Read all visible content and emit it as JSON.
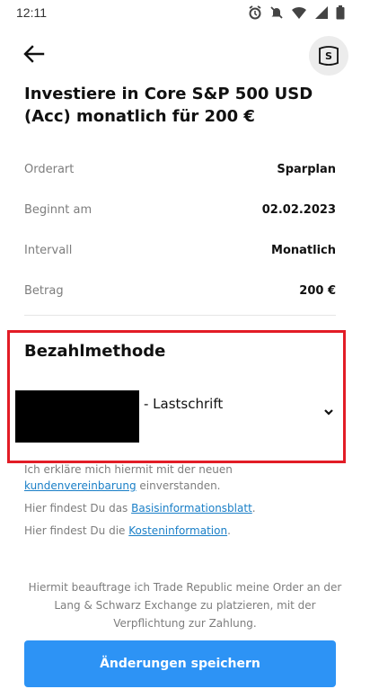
{
  "status_bar": {
    "time": "12:11",
    "icons": [
      "alarm-icon",
      "mute-icon",
      "wifi-icon",
      "signal-icon",
      "battery-icon"
    ]
  },
  "header": {
    "back_icon": "arrow-left-icon",
    "savings_icon": "savings-plan-icon",
    "savings_icon_letter": "S"
  },
  "title": "Investiere in Core S&P 500 USD (Acc) monatlich für 200 €",
  "details": [
    {
      "label": "Orderart",
      "value": "Sparplan"
    },
    {
      "label": "Beginnt am",
      "value": "02.02.2023"
    },
    {
      "label": "Intervall",
      "value": "Monatlich"
    },
    {
      "label": "Betrag",
      "value": "200 €"
    }
  ],
  "payment": {
    "heading": "Bezahlmethode",
    "method": "- Lastschrift",
    "highlight_color": "#e21c26"
  },
  "legal": {
    "line1_text": "Ich erkläre mich hiermit mit der neuen",
    "line1_link": "kundenvereinbarung",
    "line1_suffix": " einverstanden.",
    "line2_prefix": "Hier findest Du das ",
    "line2_link": "Basisinformationsblatt",
    "line2_suffix": ".",
    "line3_prefix": "Hier findest Du die ",
    "line3_link": "Kosteninformation",
    "line3_suffix": "."
  },
  "footer": {
    "disclaimer": "Hiermit beauftrage ich Trade Republic meine Order an der Lang & Schwarz Exchange zu platzieren, mit der Verpflichtung zur Zahlung.",
    "save_label": "Änderungen speichern",
    "accent_color": "#2d93f5"
  }
}
